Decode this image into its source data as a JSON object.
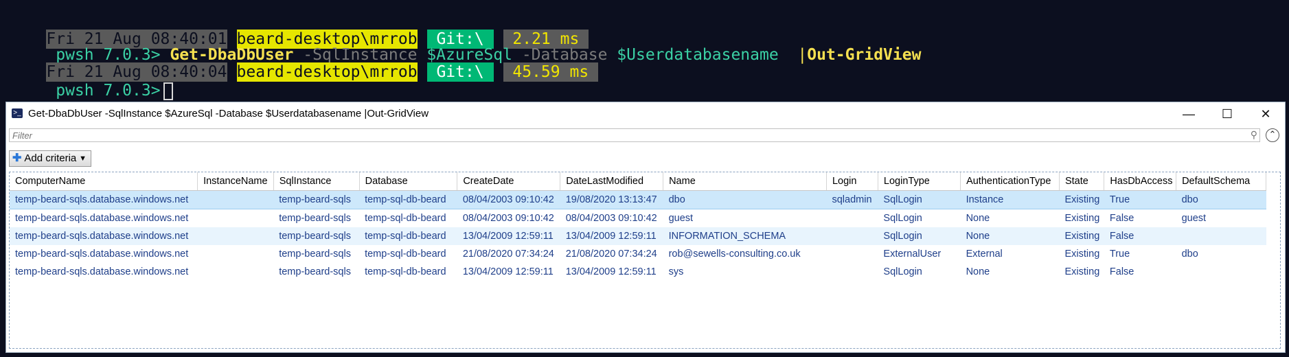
{
  "terminal": {
    "line1": {
      "time": "Fri 21 Aug 08:40:01",
      "host": "beard-desktop\\mrrob",
      "git": " Git:\\ ",
      "duration": " 2.21 ms "
    },
    "line2": {
      "prompt": " pwsh 7.0.3>",
      "cmd": "Get-DbaDbUser",
      "p1": "-SqlInstance",
      "v1": "$AzureSql",
      "p2": "-Database",
      "v2": "$Userdatabasename",
      "pipe": "|",
      "pipe_cmd": "Out-GridView"
    },
    "line3": {
      "time": "Fri 21 Aug 08:40:04",
      "host": "beard-desktop\\mrrob",
      "git": " Git:\\ ",
      "duration": " 45.59 ms "
    },
    "line4": {
      "prompt": " pwsh 7.0.3>"
    }
  },
  "window": {
    "title": "Get-DbaDbUser -SqlInstance $AzureSql -Database $Userdatabasename  |Out-GridView",
    "filter_placeholder": "Filter",
    "add_criteria": "Add criteria"
  },
  "grid": {
    "columns": [
      "ComputerName",
      "InstanceName",
      "SqlInstance",
      "Database",
      "CreateDate",
      "DateLastModified",
      "Name",
      "Login",
      "LoginType",
      "AuthenticationType",
      "State",
      "HasDbAccess",
      "DefaultSchema"
    ],
    "rows": [
      [
        "temp-beard-sqls.database.windows.net",
        "",
        "temp-beard-sqls",
        "temp-sql-db-beard",
        "08/04/2003 09:10:42",
        "19/08/2020 13:13:47",
        "dbo",
        "sqladmin",
        "SqlLogin",
        "Instance",
        "Existing",
        "True",
        "dbo"
      ],
      [
        "temp-beard-sqls.database.windows.net",
        "",
        "temp-beard-sqls",
        "temp-sql-db-beard",
        "08/04/2003 09:10:42",
        "08/04/2003 09:10:42",
        "guest",
        "",
        "SqlLogin",
        "None",
        "Existing",
        "False",
        "guest"
      ],
      [
        "temp-beard-sqls.database.windows.net",
        "",
        "temp-beard-sqls",
        "temp-sql-db-beard",
        "13/04/2009 12:59:11",
        "13/04/2009 12:59:11",
        "INFORMATION_SCHEMA",
        "",
        "SqlLogin",
        "None",
        "Existing",
        "False",
        ""
      ],
      [
        "temp-beard-sqls.database.windows.net",
        "",
        "temp-beard-sqls",
        "temp-sql-db-beard",
        "21/08/2020 07:34:24",
        "21/08/2020 07:34:24",
        "rob@sewells-consulting.co.uk",
        "",
        "ExternalUser",
        "External",
        "Existing",
        "True",
        "dbo"
      ],
      [
        "temp-beard-sqls.database.windows.net",
        "",
        "temp-beard-sqls",
        "temp-sql-db-beard",
        "13/04/2009 12:59:11",
        "13/04/2009 12:59:11",
        "sys",
        "",
        "SqlLogin",
        "None",
        "Existing",
        "False",
        ""
      ]
    ]
  }
}
